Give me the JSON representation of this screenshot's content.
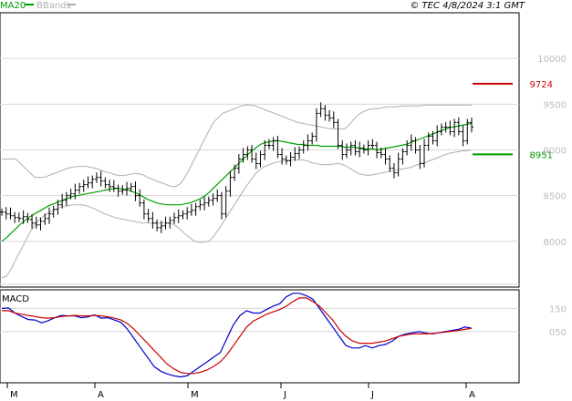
{
  "header": {
    "legend_ma": "MA20",
    "legend_bbands": "BBands",
    "copyright": "© TEC 4/8/2024 3:1 GMT"
  },
  "colors": {
    "price": "#000000",
    "ma": "#00a000",
    "bbands": "#b0b0b0",
    "resistance": "#cc0000",
    "support": "#009900",
    "macd": "#0000cc",
    "signal": "#cc0000",
    "grid": "#d8d8d8"
  },
  "chart_data": [
    {
      "type": "ohlc",
      "title": "",
      "y_ticks": [
        10000,
        9500,
        9000,
        8500,
        8000
      ],
      "y_tick_labels": [
        "10000",
        "9500",
        "9000",
        "8500",
        "8000"
      ],
      "ylim": [
        7500,
        10500
      ],
      "x_ticks": [
        "M",
        "A",
        "M",
        "J",
        "J",
        "A"
      ],
      "levels": [
        {
          "name": "resistance",
          "value": 9724,
          "label": "9724"
        },
        {
          "name": "support",
          "value": 8951,
          "label": "8951"
        }
      ],
      "series": [
        {
          "name": "MA20",
          "values": [
            8000,
            8040,
            8090,
            8140,
            8190,
            8230,
            8270,
            8300,
            8330,
            8360,
            8390,
            8410,
            8430,
            8450,
            8470,
            8490,
            8500,
            8510,
            8520,
            8530,
            8540,
            8550,
            8560,
            8570,
            8580,
            8580,
            8570,
            8560,
            8540,
            8520,
            8490,
            8460,
            8440,
            8420,
            8410,
            8400,
            8400,
            8400,
            8400,
            8410,
            8420,
            8440,
            8460,
            8490,
            8530,
            8580,
            8630,
            8680,
            8730,
            8780,
            8830,
            8880,
            8930,
            8980,
            9020,
            9060,
            9080,
            9090,
            9100,
            9100,
            9090,
            9080,
            9070,
            9060,
            9060,
            9050,
            9050,
            9050,
            9040,
            9040,
            9040,
            9040,
            9040,
            9030,
            9030,
            9030,
            9020,
            9010,
            9010,
            9010,
            9000,
            9010,
            9020,
            9030,
            9040,
            9050,
            9060,
            9080,
            9100,
            9120,
            9140,
            9160,
            9180,
            9200,
            9220,
            9240,
            9250,
            9260,
            9270,
            9280,
            9290
          ]
        },
        {
          "name": "BBands upper",
          "values": [
            8900,
            8900,
            8900,
            8900,
            8850,
            8800,
            8750,
            8700,
            8700,
            8700,
            8720,
            8740,
            8760,
            8780,
            8800,
            8810,
            8820,
            8820,
            8820,
            8810,
            8800,
            8780,
            8760,
            8750,
            8730,
            8720,
            8720,
            8730,
            8740,
            8740,
            8730,
            8700,
            8680,
            8660,
            8640,
            8620,
            8600,
            8600,
            8630,
            8700,
            8800,
            8900,
            9000,
            9100,
            9200,
            9300,
            9350,
            9400,
            9420,
            9440,
            9460,
            9480,
            9490,
            9490,
            9480,
            9460,
            9440,
            9420,
            9400,
            9380,
            9360,
            9340,
            9320,
            9300,
            9290,
            9280,
            9270,
            9260,
            9250,
            9240,
            9230,
            9230,
            9230,
            9230,
            9280,
            9340,
            9390,
            9420,
            9440,
            9450,
            9450,
            9460,
            9470,
            9470,
            9470,
            9480,
            9480,
            9480,
            9480,
            9480,
            9490,
            9490,
            9490,
            9490,
            9490,
            9490,
            9490,
            9490,
            9490,
            9490,
            9490
          ]
        },
        {
          "name": "BBands lower",
          "values": [
            7600,
            7620,
            7700,
            7800,
            7900,
            8000,
            8100,
            8180,
            8240,
            8280,
            8310,
            8340,
            8360,
            8380,
            8390,
            8400,
            8400,
            8400,
            8390,
            8370,
            8350,
            8320,
            8300,
            8280,
            8260,
            8250,
            8240,
            8230,
            8220,
            8210,
            8200,
            8200,
            8200,
            8200,
            8200,
            8200,
            8200,
            8170,
            8130,
            8080,
            8040,
            8000,
            7990,
            7990,
            8000,
            8050,
            8120,
            8200,
            8280,
            8360,
            8440,
            8520,
            8600,
            8670,
            8740,
            8790,
            8820,
            8840,
            8860,
            8870,
            8880,
            8890,
            8890,
            8890,
            8890,
            8880,
            8860,
            8850,
            8840,
            8840,
            8840,
            8850,
            8850,
            8830,
            8800,
            8770,
            8740,
            8730,
            8720,
            8730,
            8740,
            8750,
            8760,
            8770,
            8780,
            8790,
            8800,
            8810,
            8830,
            8850,
            8860,
            8880,
            8900,
            8920,
            8940,
            8960,
            8970,
            8980,
            8990,
            8990,
            9000
          ]
        }
      ],
      "price_series": {
        "name": "Price",
        "close": [
          8320,
          8300,
          8280,
          8260,
          8250,
          8270,
          8240,
          8200,
          8180,
          8220,
          8250,
          8300,
          8350,
          8400,
          8450,
          8500,
          8520,
          8560,
          8600,
          8620,
          8640,
          8680,
          8700,
          8660,
          8620,
          8600,
          8580,
          8550,
          8560,
          8580,
          8600,
          8500,
          8420,
          8300,
          8250,
          8200,
          8150,
          8170,
          8200,
          8230,
          8260,
          8280,
          8300,
          8320,
          8340,
          8380,
          8400,
          8420,
          8450,
          8470,
          8500,
          8300,
          8550,
          8700,
          8800,
          8900,
          8950,
          9000,
          8900,
          8850,
          8950,
          9050,
          9050,
          9100,
          8950,
          8900,
          8880,
          8920,
          8960,
          9000,
          9050,
          9100,
          9150,
          9400,
          9450,
          9380,
          9350,
          9300,
          9050,
          8950,
          9000,
          9050,
          8980,
          9020,
          9000,
          9050,
          9050,
          8970,
          8950,
          8900,
          8800,
          8750,
          8900,
          8980,
          9050,
          9100,
          9000,
          8850,
          9050,
          9150,
          9100,
          9200,
          9250,
          9250,
          9200,
          9300,
          9200,
          9100,
          9300,
          9250
        ]
      }
    },
    {
      "type": "line",
      "title": "MACD",
      "y_tick_labels": [
        "150",
        "050"
      ],
      "x_ticks": [
        "M",
        "A",
        "M",
        "J",
        "J",
        "A"
      ],
      "series": [
        {
          "name": "MACD",
          "values": [
            150,
            152,
            130,
            115,
            102,
            100,
            88,
            97,
            110,
            120,
            118,
            118,
            110,
            113,
            122,
            108,
            110,
            100,
            90,
            60,
            20,
            -20,
            -60,
            -100,
            -120,
            -132,
            -140,
            -145,
            -140,
            -120,
            -100,
            -80,
            -60,
            -40,
            20,
            80,
            120,
            140,
            130,
            130,
            145,
            160,
            170,
            200,
            215,
            215,
            205,
            190,
            150,
            110,
            70,
            30,
            -10,
            -20,
            -20,
            -10,
            -20,
            -10,
            -5,
            10,
            30,
            40,
            45,
            50,
            45,
            40,
            45,
            50,
            55,
            60,
            70,
            65
          ]
        },
        {
          "name": "Signal",
          "values": [
            140,
            140,
            130,
            125,
            120,
            115,
            110,
            108,
            110,
            115,
            118,
            120,
            118,
            118,
            120,
            118,
            114,
            108,
            100,
            85,
            60,
            30,
            0,
            -30,
            -60,
            -90,
            -110,
            -125,
            -130,
            -130,
            -125,
            -115,
            -100,
            -80,
            -50,
            -10,
            30,
            70,
            95,
            110,
            125,
            135,
            145,
            160,
            180,
            195,
            195,
            180,
            160,
            130,
            100,
            60,
            30,
            10,
            0,
            0,
            0,
            5,
            10,
            20,
            30,
            35,
            40,
            40,
            40,
            42,
            45,
            48,
            52,
            55,
            60,
            65
          ]
        }
      ]
    }
  ]
}
